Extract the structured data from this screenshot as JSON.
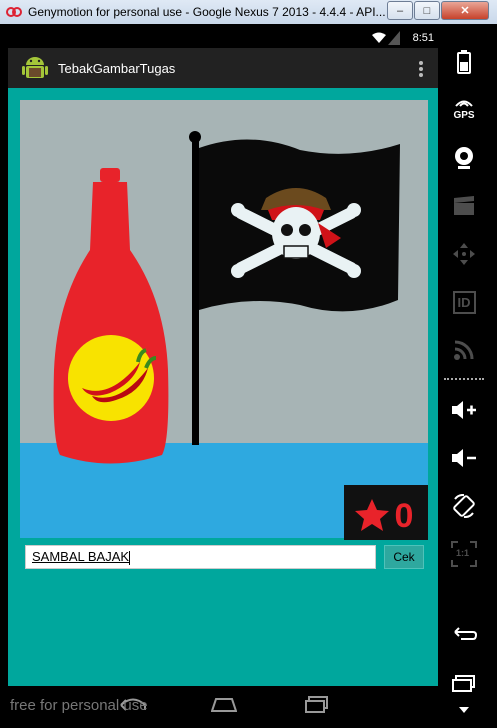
{
  "window": {
    "title": "Genymotion for personal use - Google Nexus 7 2013 - 4.4.4 - API...",
    "minimize_label": "–",
    "maximize_label": "□",
    "close_label": "✕"
  },
  "statusbar": {
    "time": "8:51"
  },
  "actionbar": {
    "app_title": "TebakGambarTugas"
  },
  "game": {
    "score": "0",
    "answer_value": "SAMBAL BAJAK",
    "check_button_label": "Cek"
  },
  "watermark": "free for personal use",
  "sidebar": {
    "gps_label": "GPS",
    "id_label": "ID",
    "ratio_label": "1:1"
  },
  "colors": {
    "content_bg": "#00a79d",
    "sky": "#a7b4b5",
    "water": "#2ea9e0",
    "bottle": "#e8232a",
    "label": "#f8e300",
    "flag": "#0a0a0a"
  },
  "icons": [
    "battery-icon",
    "gps-icon",
    "webcam-icon",
    "clapper-icon",
    "move-icon",
    "id-icon",
    "rss-icon",
    "volume-up-icon",
    "volume-down-icon",
    "rotate-icon",
    "scale-icon",
    "back-icon",
    "home-icon",
    "recent-apps-icon",
    "menu-icon",
    "star-icon",
    "overflow-menu-icon",
    "android-logo-icon",
    "wifi-icon",
    "signal-icon"
  ]
}
